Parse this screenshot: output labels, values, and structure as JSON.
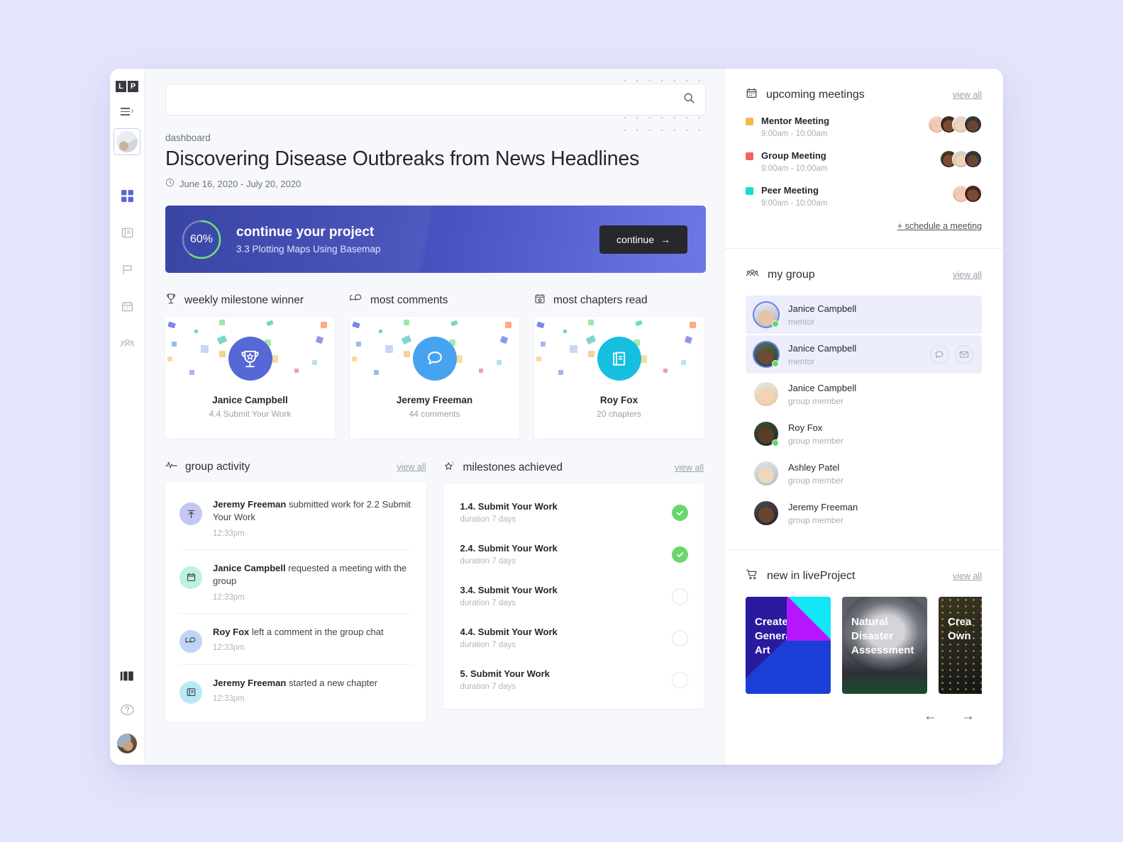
{
  "brand": {
    "logo_left": "L",
    "logo_right": "P"
  },
  "rail": {
    "menu_icon": "hamburger-chevron-icon",
    "project_thumb": "project-thumbnail",
    "items": [
      {
        "name": "dashboard",
        "icon": "grid-icon",
        "active": true
      },
      {
        "name": "chapters",
        "icon": "book-icon",
        "active": false
      },
      {
        "name": "milestones",
        "icon": "flag-icon",
        "active": false
      },
      {
        "name": "calendar",
        "icon": "calendar-icon",
        "active": false
      },
      {
        "name": "group",
        "icon": "people-icon",
        "active": false
      }
    ],
    "bottom": [
      {
        "name": "library",
        "icon": "book-pages-icon"
      },
      {
        "name": "help",
        "icon": "question-mark-icon"
      },
      {
        "name": "profile",
        "icon": "user-avatar"
      }
    ]
  },
  "search": {
    "value": "",
    "placeholder": "",
    "icon": "search-icon"
  },
  "header": {
    "breadcrumb": "dashboard",
    "title": "Discovering Disease Outbreaks from News Headlines",
    "date_icon": "clock-icon",
    "date_range": "June 16, 2020 - July 20, 2020"
  },
  "banner": {
    "progress_percent": 60,
    "progress_label": "60%",
    "title": "continue your project",
    "subtitle": "3.3 Plotting Maps Using Basemap",
    "button_label": "continue",
    "button_icon": "arrow-right-icon",
    "ring_color": "#5ee06a",
    "bg_from": "#2e3a9e",
    "bg_to": "#6d78e8"
  },
  "awards": [
    {
      "section_icon": "trophy-icon",
      "section_title": "weekly milestone winner",
      "badge_icon": "trophy-badge-icon",
      "badge_color": "#5667d6",
      "name": "Janice Campbell",
      "detail": "4.4 Submit Your Work"
    },
    {
      "section_icon": "comments-icon",
      "section_title": "most comments",
      "badge_icon": "speech-bubble-icon",
      "badge_color": "#46a3f0",
      "name": "Jeremy Freeman",
      "detail": "44 comments"
    },
    {
      "section_icon": "book-calendar-icon",
      "section_title": "most chapters read",
      "badge_icon": "book-badge-icon",
      "badge_color": "#16bfe0",
      "name": "Roy Fox",
      "detail": "20 chapters"
    }
  ],
  "group_activity": {
    "section_icon": "pulse-icon",
    "section_title": "group activity",
    "view_all": "view all",
    "items": [
      {
        "icon": "upload-icon",
        "icon_bg": "#c3c7f2",
        "actor": "Jeremy Freeman",
        "text": " submitted work for 2.2 Submit Your Work",
        "time": "12:33pm"
      },
      {
        "icon": "calendar-icon",
        "icon_bg": "#bdf0e1",
        "actor": "Janice Campbell",
        "text": " requested a meeting with the group",
        "time": "12:33pm"
      },
      {
        "icon": "comments-icon",
        "icon_bg": "#bfd4f7",
        "actor": "Roy Fox",
        "text": " left a comment in the group chat",
        "time": "12:33pm"
      },
      {
        "icon": "book-icon",
        "icon_bg": "#b9e9f5",
        "actor": "Jeremy Freeman",
        "text": " started a new chapter",
        "time": "12:33pm"
      }
    ]
  },
  "milestones": {
    "section_icon": "star-sparkle-icon",
    "section_title": "milestones achieved",
    "view_all": "view all",
    "items": [
      {
        "label": "1.4. Submit Your Work",
        "duration": "duration 7 days",
        "done": true
      },
      {
        "label": "2.4. Submit Your Work",
        "duration": "duration 7 days",
        "done": true
      },
      {
        "label": "3.4. Submit Your Work",
        "duration": "duration 7 days",
        "done": false
      },
      {
        "label": "4.4. Submit Your Work",
        "duration": "duration 7 days",
        "done": false
      },
      {
        "label": "5. Submit Your Work",
        "duration": "duration 7 days",
        "done": false
      }
    ],
    "done_color": "#6bd76b"
  },
  "meetings": {
    "section_icon": "calendar-icon",
    "section_title": "upcoming meetings",
    "view_all": "view all",
    "schedule_label": "+ schedule a meeting",
    "items": [
      {
        "swatch": "#f5b94b",
        "title": "Mentor Meeting",
        "time": "9:00am - 10:00am",
        "avatars": 4
      },
      {
        "swatch": "#f8605f",
        "title": "Group Meeting",
        "time": "9:00am - 10:00am",
        "avatars": 3
      },
      {
        "swatch": "#14dfce",
        "title": "Peer Meeting",
        "time": "9:00am - 10:00am",
        "avatars": 2
      }
    ]
  },
  "my_group": {
    "section_icon": "people-icon",
    "section_title": "my group",
    "view_all": "view all",
    "chat_icon": "chat-bubble-icon",
    "mail_icon": "envelope-icon",
    "members": [
      {
        "name": "Janice Campbell",
        "role": "mentor",
        "online": true,
        "highlight": true,
        "ring": true,
        "actions": false
      },
      {
        "name": "Janice Campbell",
        "role": "mentor",
        "online": true,
        "highlight": true,
        "ring": true,
        "actions": true
      },
      {
        "name": "Janice Campbell",
        "role": "group member",
        "online": false,
        "highlight": false,
        "ring": false,
        "actions": false
      },
      {
        "name": "Roy Fox",
        "role": "group member",
        "online": true,
        "highlight": false,
        "ring": false,
        "actions": false
      },
      {
        "name": "Ashley Patel",
        "role": "group member",
        "online": false,
        "highlight": false,
        "ring": false,
        "actions": false
      },
      {
        "name": "Jeremy Freeman",
        "role": "group member",
        "online": false,
        "highlight": false,
        "ring": false,
        "actions": false
      }
    ]
  },
  "new_liveproject": {
    "section_icon": "cart-icon",
    "section_title": "new in liveProject",
    "view_all": "view all",
    "cards": [
      {
        "title": "Create\nGenerative\nArt",
        "style": "c1"
      },
      {
        "title": "Natural\nDisaster\nAssessment",
        "style": "c2"
      },
      {
        "title": "Crea\nOwn",
        "style": "c3"
      }
    ],
    "prev_icon": "arrow-left-icon",
    "next_icon": "arrow-right-icon"
  }
}
